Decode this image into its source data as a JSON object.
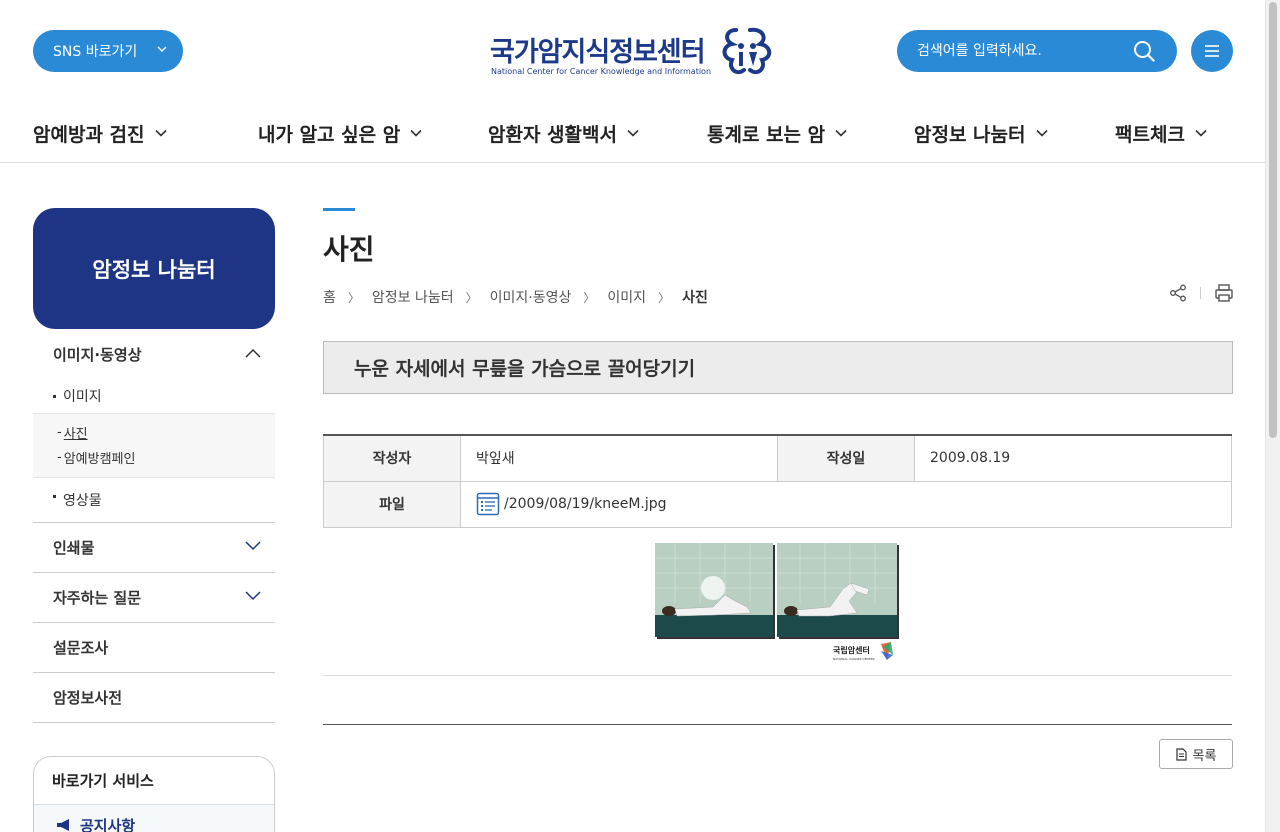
{
  "header": {
    "sns_label": "SNS 바로가기",
    "logo_title": "국가암지식정보센터",
    "logo_subtitle": "National Center for Cancer Knowledge and Information",
    "search_placeholder": "검색어를 입력하세요."
  },
  "gnb": [
    {
      "label": "암예방과 검진"
    },
    {
      "label": "내가 알고 싶은 암"
    },
    {
      "label": "암환자 생활백서"
    },
    {
      "label": "통계로 보는 암"
    },
    {
      "label": "암정보 나눔터"
    },
    {
      "label": "팩트체크"
    }
  ],
  "sidebar": {
    "title": "암정보 나눔터",
    "section_open": "이미지·동영상",
    "sub_image": "이미지",
    "sub_image_children": [
      "사진",
      "암예방캠페인"
    ],
    "sub_video": "영상물",
    "sections": [
      "인쇄물",
      "자주하는 질문",
      "설문조사",
      "암정보사전"
    ]
  },
  "quick": {
    "title": "바로가기 서비스",
    "item": "공지사항"
  },
  "content": {
    "page_title": "사진",
    "breadcrumb": [
      "홈",
      "암정보 나눔터",
      "이미지·동영상",
      "이미지",
      "사진"
    ],
    "post_title": "누운 자세에서 무릎을 가슴으로 끌어당기기",
    "author_label": "작성자",
    "author": "박잎새",
    "date_label": "작성일",
    "date": "2009.08.19",
    "file_label": "파일",
    "file": "/2009/08/19/kneeM.jpg",
    "photo_watermark": "국립암센터",
    "photo_watermark_sub": "NATIONAL CANCER CENTER",
    "list_button": "목록"
  },
  "colors": {
    "primary_blue": "#2b8ad6",
    "navy": "#1d3584"
  }
}
